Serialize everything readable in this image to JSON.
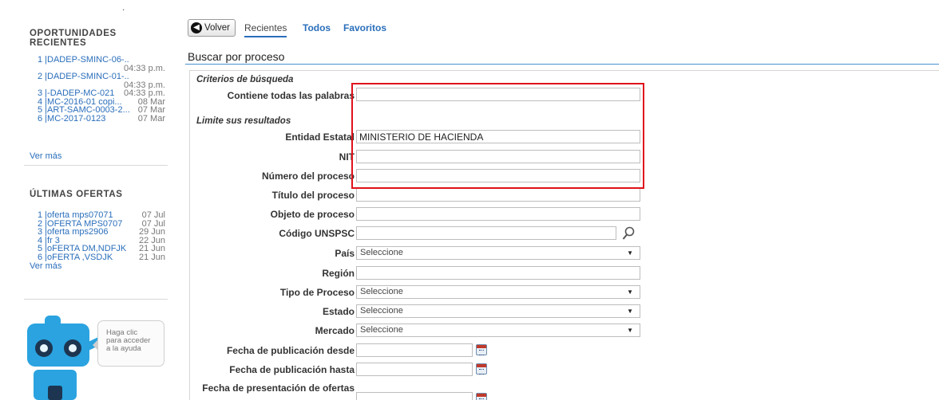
{
  "sidebar": {
    "dot": ".",
    "recent_title_line1": "OPORTUNIDADES",
    "recent_title_line2": "RECIENTES",
    "recent_items": [
      {
        "text": "1 |DADEP-SMINC-06-...",
        "date": "04:33 p.m."
      },
      {
        "text": "2 |DADEP-SMINC-01-...",
        "date": "04:33 p.m."
      },
      {
        "text": "3 |-DADEP-MC-021",
        "date": "04:33 p.m."
      },
      {
        "text": "4 |MC-2016-01 copi...",
        "date": "08 Mar"
      },
      {
        "text": "5 |ART-SAMC-0003-2...",
        "date": "07 Mar"
      },
      {
        "text": "6 |MC-2017-0123",
        "date": "07 Mar"
      }
    ],
    "recent_more": "Ver más",
    "offers_title": "ÚLTIMAS OFERTAS",
    "offer_items": [
      {
        "text": "1 |oferta mps07071",
        "date": "07 Jul"
      },
      {
        "text": "2 |OFERTA MPS0707",
        "date": "07 Jul"
      },
      {
        "text": "3 |oferta mps2906",
        "date": "29 Jun"
      },
      {
        "text": "4 |fr 3",
        "date": "22 Jun"
      },
      {
        "text": "5 |oFERTA DM,NDFJK",
        "date": "21 Jun"
      },
      {
        "text": "6 |oFERTA ,VSDJK",
        "date": "21 Jun"
      }
    ],
    "offers_more": "Ver más",
    "help_bubble": [
      "Haga clic",
      "para acceder",
      "a la ayuda"
    ]
  },
  "topbar": {
    "back_label": "Volver",
    "tabs": [
      "Recientes",
      "Todos",
      "Favoritos"
    ]
  },
  "search": {
    "title": "Buscar por proceso",
    "criteria_label": "Criterios de búsqueda",
    "limit_label": "Limite sus resultados",
    "fields": {
      "all_words": {
        "label": "Contiene todas las palabras",
        "value": ""
      },
      "entity": {
        "label": "Entidad Estatal",
        "value": "MINISTERIO DE HACIENDA"
      },
      "nit": {
        "label": "NIT",
        "value": ""
      },
      "process_number": {
        "label": "Número del proceso",
        "value": ""
      },
      "process_title": {
        "label": "Título del proceso",
        "value": ""
      },
      "process_object": {
        "label": "Objeto de proceso",
        "value": ""
      },
      "unspsc": {
        "label": "Código UNSPSC",
        "value": ""
      },
      "country": {
        "label": "País",
        "value": "Seleccione"
      },
      "region": {
        "label": "Región",
        "value": ""
      },
      "process_type": {
        "label": "Tipo de Proceso",
        "value": "Seleccione"
      },
      "state": {
        "label": "Estado",
        "value": "Seleccione"
      },
      "market": {
        "label": "Mercado",
        "value": "Seleccione"
      },
      "pub_from": {
        "label": "Fecha de publicación desde",
        "value": ""
      },
      "pub_to": {
        "label": "Fecha de publicación hasta",
        "value": ""
      },
      "offers_date": {
        "label": "Fecha de presentación de ofertas",
        "value": ""
      }
    }
  },
  "colors": {
    "link": "#2a6ebb",
    "highlight": "#e0111a",
    "section_line": "#4a90d0"
  }
}
